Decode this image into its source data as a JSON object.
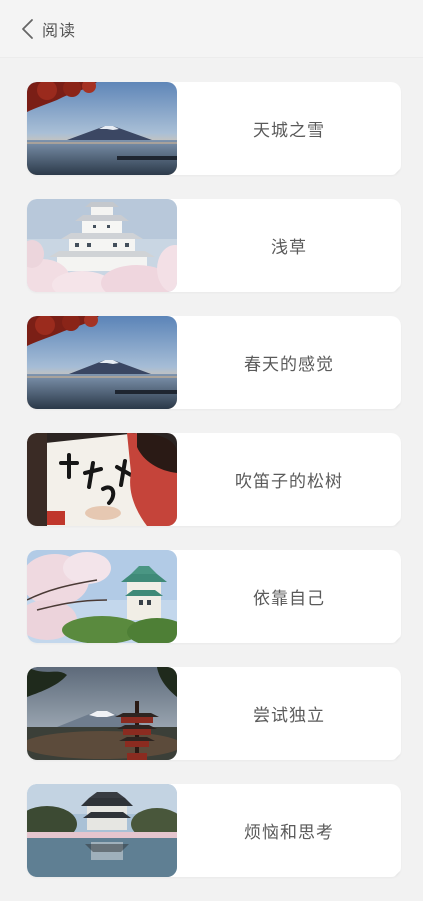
{
  "header": {
    "back_label": "阅读",
    "back_icon": "chevron-left-icon"
  },
  "items": [
    {
      "title": "天城之雪",
      "scene": "mount-fuji-lake-maple"
    },
    {
      "title": "浅草",
      "scene": "white-castle-cherry-blossoms"
    },
    {
      "title": "春天的感觉",
      "scene": "mount-fuji-lake-maple"
    },
    {
      "title": "吹笛子的松树",
      "scene": "calligraphy-kimono"
    },
    {
      "title": "依靠自己",
      "scene": "castle-tower-cherry-blossoms"
    },
    {
      "title": "尝试独立",
      "scene": "pagoda-mount-fuji"
    },
    {
      "title": "烦恼和思考",
      "scene": "castle-reflection-pond"
    }
  ],
  "colors": {
    "background": "#f2f2f2",
    "card": "#ffffff",
    "title_text": "#5a5a5a"
  }
}
